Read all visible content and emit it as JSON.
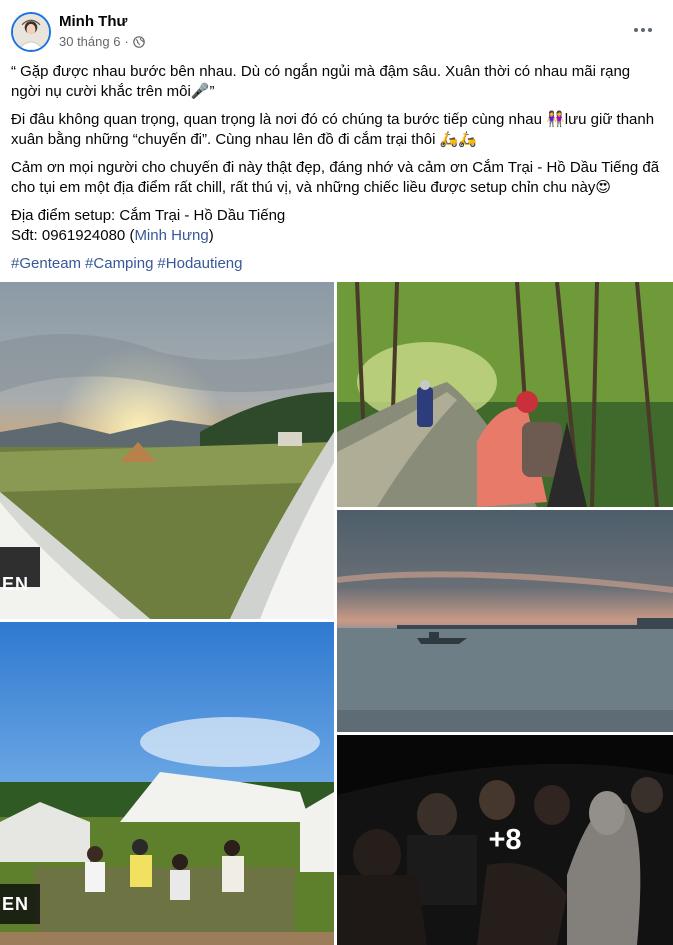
{
  "post": {
    "author": "Minh Thư",
    "date": "30 tháng 6",
    "separator": "·",
    "privacy_icon": "globe-icon",
    "more_icon": "more-horizontal-icon"
  },
  "content": {
    "line1": "“ Gặp được nhau bước bên nhau. Dù có ngắn ngủi mà đậm sâu. Xuân thời có nhau mãi rạng ngời nụ cười khắc trên môi🎤”",
    "line2": "Đi đâu không quan trọng, quan trọng là nơi đó có chúng ta bước tiếp cùng nhau 👭lưu giữ thanh xuân bằng những “chuyến đi”. Cùng nhau lên đồ đi cắm trại thôi 🛵🛵",
    "line3": "Cảm ơn mọi người cho chuyến đi này thật đẹp, đáng nhớ và cảm ơn Cắm Trại - Hồ Dầu Tiếng đã cho tụi em một địa điểm rất chill, rất thú vị, và những chiếc liều được setup chỉn chu này😍",
    "location": "Địa điểm setup: Cắm Trại - Hồ Dầu Tiếng",
    "phone_prefix": "Sđt: 0961924080 (",
    "phone_link": "Minh Hưng",
    "phone_suffix": ")",
    "hashtags": [
      "#Genteam",
      "#Camping",
      "#Hodautieng"
    ]
  },
  "gallery": {
    "more_count": "+8",
    "photos": [
      {
        "subject": "sunset-camp-tents"
      },
      {
        "subject": "motorbike-forest-road"
      },
      {
        "subject": "lake-twilight-boat"
      },
      {
        "subject": "group-photo-campsite"
      },
      {
        "subject": "friends-night-tent"
      }
    ],
    "watermark": "EN"
  },
  "colors": {
    "link": "#385898",
    "secondary_text": "#65676b",
    "avatar_ring": "#1b74e4"
  }
}
